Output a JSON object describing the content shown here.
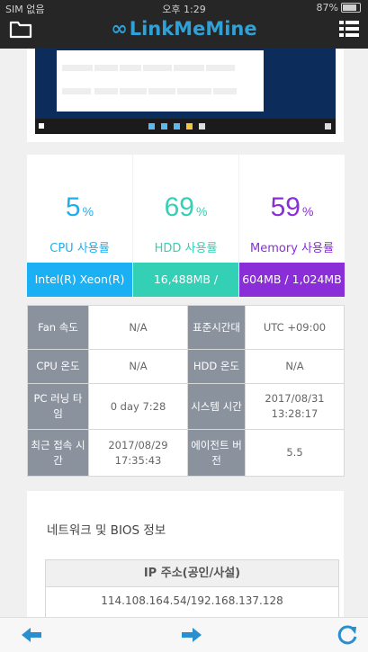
{
  "status_bar": {
    "carrier": "SIM 없음",
    "time": "오후 1:29",
    "battery": "87%"
  },
  "header": {
    "app_name": "LinkMeMine"
  },
  "stats": [
    {
      "value": "5",
      "unit": "%",
      "label": "CPU 사용률",
      "detail": "Intel(R) Xeon(R)",
      "accent": "#1db0f0",
      "foot_color": "#1bb0f3"
    },
    {
      "value": "69",
      "unit": "%",
      "label": "HDD 사용률",
      "detail": "16,488MB /",
      "accent": "#36d0b6",
      "foot_color": "#33d0b5"
    },
    {
      "value": "59",
      "unit": "%",
      "label": "Memory 사용률",
      "detail": "604MB / 1,024MB",
      "accent": "#8a2ed8",
      "foot_color": "#8a2ed8"
    }
  ],
  "info": {
    "fan_label": "Fan 속도",
    "fan_value": "N/A",
    "tz_label": "표준시간대",
    "tz_value": "UTC +09:00",
    "cpu_temp_label": "CPU 온도",
    "cpu_temp_value": "N/A",
    "hdd_temp_label": "HDD 온도",
    "hdd_temp_value": "N/A",
    "uptime_label": "PC 러닝 타임",
    "uptime_value": "0 day 7:28",
    "systime_label": "시스템 시간",
    "systime_value": "2017/08/31 13:28:17",
    "last_access_label": "최근 접속 시간",
    "last_access_value": "2017/08/29 17:35:43",
    "agent_label": "에이전트 버전",
    "agent_value": "5.5"
  },
  "network": {
    "title": "네트워크 및 BIOS 정보",
    "ip_header": "IP 주소(공인/사설)",
    "ip_value": "114.108.164.54/192.168.137.128"
  },
  "colors": {
    "topbar": "#262626",
    "brand": "#2fa1d6",
    "nav_icon": "#2a8fd0"
  },
  "icons": [
    "folder-icon",
    "infinity-logo-icon",
    "menu-icon",
    "back-arrow-icon",
    "forward-arrow-icon",
    "refresh-icon"
  ]
}
